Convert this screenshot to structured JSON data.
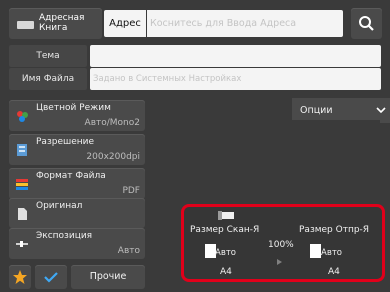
{
  "top_bar": {
    "address_book_label": "Адресная Книга",
    "address_label": "Адрес",
    "address_placeholder": "Коснитесь для Ввода Адреса"
  },
  "fields": {
    "subject_label": "Тема",
    "subject_value": "",
    "filename_label": "Имя Файла",
    "filename_placeholder": "Задано в Системных Настройках"
  },
  "settings": [
    {
      "title": "Цветной Режим",
      "value": "Авто/Mono2",
      "icon": "color-mode-icon"
    },
    {
      "title": "Разрешение",
      "value": "200x200dpi",
      "icon": "resolution-icon"
    },
    {
      "title": "Формат Файла",
      "value": "PDF",
      "icon": "file-format-icon"
    },
    {
      "title": "Оригинал",
      "value": "",
      "icon": "original-icon"
    },
    {
      "title": "Экспозиция",
      "value": "Авто",
      "icon": "exposure-icon"
    }
  ],
  "bottom": {
    "other_label": "Прочие"
  },
  "options": {
    "label": "Опции"
  },
  "preview": {
    "scan_size_label": "Размер Скан-Я",
    "scan_size_mode": "Авто",
    "scan_size_paper": "A4",
    "ratio": "100%",
    "send_size_label": "Размер Отпр-Я",
    "send_size_mode": "Авто",
    "send_size_paper": "A4"
  },
  "colors": {
    "highlight_border": "#e1001a",
    "check_icon": "#3fa9f5",
    "star_icon": "#f5a623"
  }
}
